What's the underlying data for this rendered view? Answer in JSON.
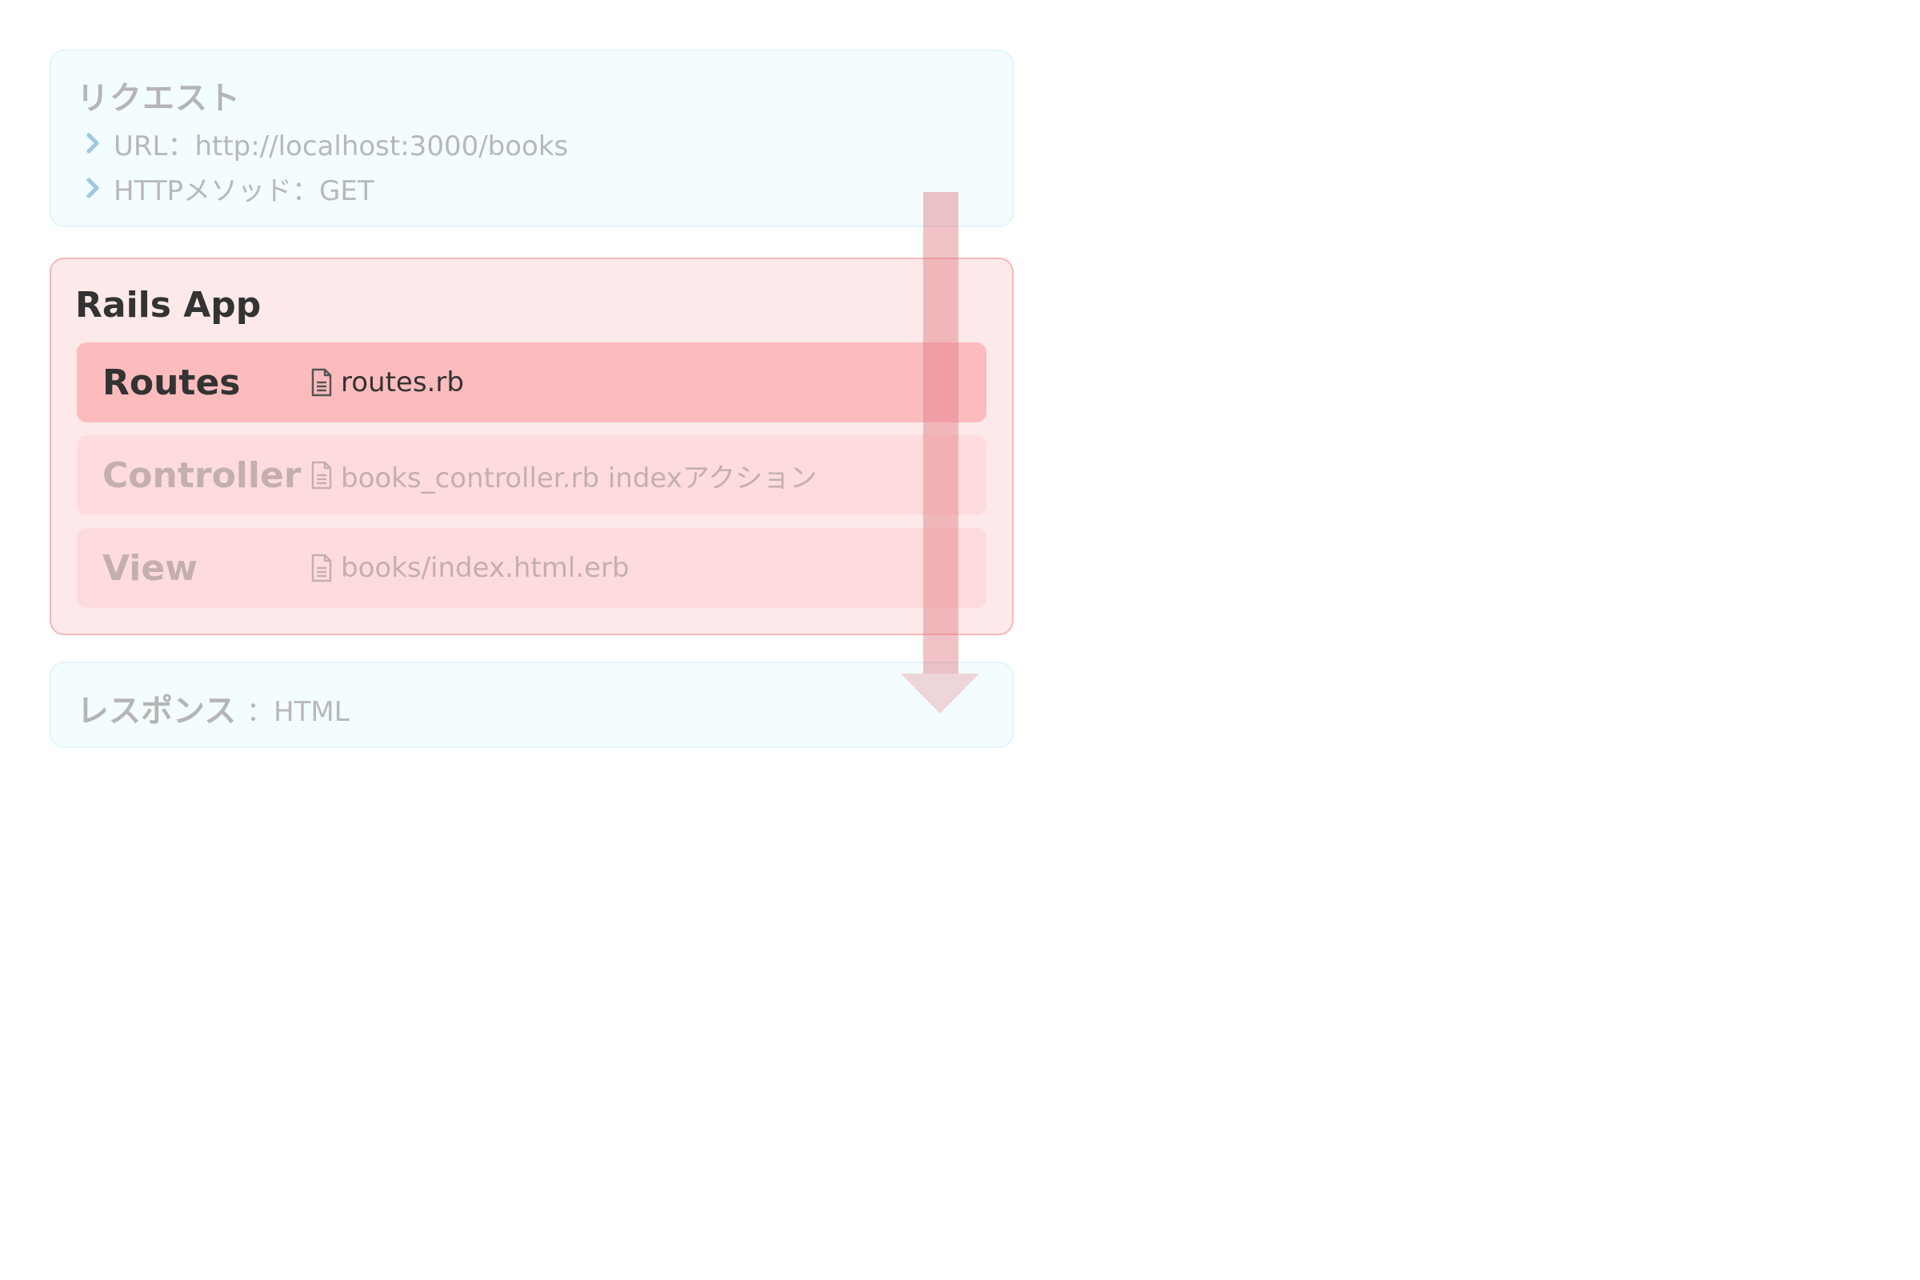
{
  "request": {
    "title": "リクエスト",
    "items": [
      {
        "icon": "chevron-right-icon",
        "text": "URL：http://localhost:3000/books"
      },
      {
        "icon": "chevron-right-icon",
        "text": "HTTPメソッド：GET"
      }
    ]
  },
  "rails_app": {
    "title": "Rails App",
    "components": [
      {
        "label": "Routes",
        "file_icon": "file-icon",
        "file": "routes.rb",
        "state": "active"
      },
      {
        "label": "Controller",
        "file_icon": "file-icon",
        "file": "books_controller.rb indexアクション",
        "state": "inactive"
      },
      {
        "label": "View",
        "file_icon": "file-icon",
        "file": "books/index.html.erb",
        "state": "inactive"
      }
    ]
  },
  "response": {
    "title": "レスポンス",
    "value": "：HTML"
  },
  "colors": {
    "request_bg": "#f3fcfe",
    "rails_bg": "#fee9ea",
    "rails_border": "#f5b7b9",
    "active_row": "#fcbcbe",
    "inactive_row": "#fedcdd",
    "arrow": "#e5a0a6",
    "chevron": "#9cc8e0"
  }
}
